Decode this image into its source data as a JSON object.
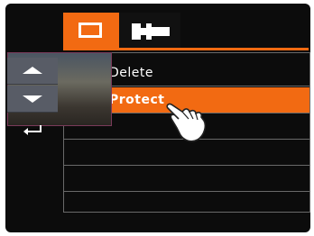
{
  "tabs": [
    {
      "icon": "playback-icon",
      "active": true
    },
    {
      "icon": "wrench-icon",
      "active": false
    }
  ],
  "menu": {
    "items": [
      {
        "label": "Delete",
        "icon": "trash-icon",
        "selected": false
      },
      {
        "label": "Protect",
        "icon": "lock-icon",
        "selected": true
      },
      {
        "label": "",
        "selected": false
      },
      {
        "label": "",
        "selected": false
      },
      {
        "label": "",
        "selected": false
      }
    ]
  },
  "nav": {
    "up_icon": "arrow-up-icon",
    "down_icon": "arrow-down-icon",
    "return_icon": "return-icon"
  },
  "pointer": {
    "icon": "pointing-hand-icon"
  },
  "colors": {
    "accent": "#f26a12",
    "background": "#0c0c0c",
    "divider": "#6a6a6a"
  }
}
